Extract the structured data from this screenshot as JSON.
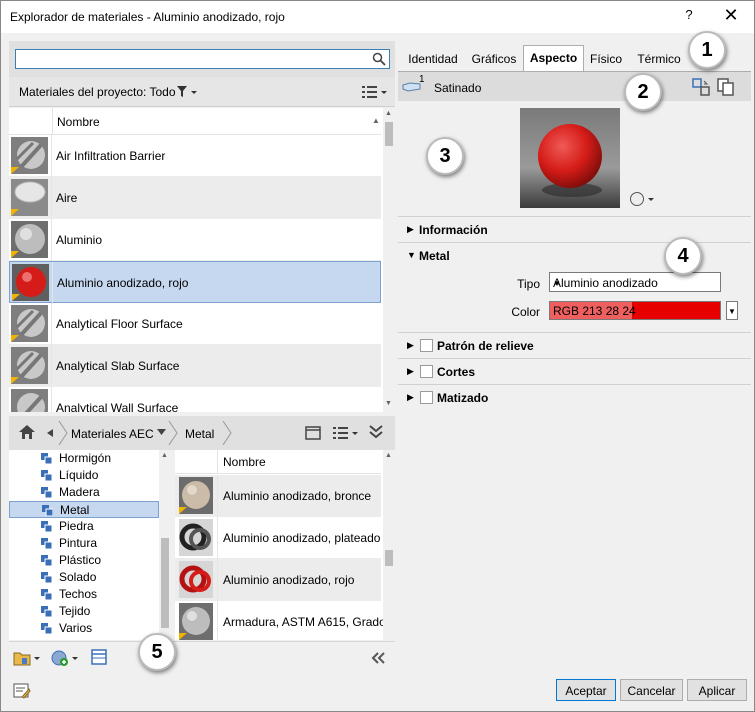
{
  "window": {
    "title": "Explorador de materiales - Aluminio anodizado, rojo",
    "help_label": "?",
    "close_label": "✕"
  },
  "search": {
    "value": "",
    "placeholder": ""
  },
  "project": {
    "filter_label": "Materiales del proyecto: Todo",
    "column_name": "Nombre",
    "materials": [
      {
        "name": "Air Infiltration Barrier",
        "thumb": "striped-sphere-icon"
      },
      {
        "name": "Aire",
        "thumb": "white-sphere-icon"
      },
      {
        "name": "Aluminio",
        "thumb": "grey-sphere-icon"
      },
      {
        "name": "Aluminio anodizado, rojo",
        "thumb": "red-sphere-icon",
        "selected": true
      },
      {
        "name": "Analytical Floor Surface",
        "thumb": "striped-sphere-icon"
      },
      {
        "name": "Analytical Slab Surface",
        "thumb": "striped-sphere-icon"
      },
      {
        "name": "Analytical Wall Surface",
        "thumb": "striped-sphere-icon"
      }
    ]
  },
  "library": {
    "breadcrumb": [
      "Materiales AEC",
      "Metal"
    ],
    "tree": [
      "Hormigón",
      "Líquido",
      "Madera",
      "Metal",
      "Piedra",
      "Pintura",
      "Plástico",
      "Solado",
      "Techos",
      "Tejido",
      "Varios"
    ],
    "tree_selected": "Metal",
    "column_name": "Nombre",
    "items": [
      {
        "name": "Aluminio anodizado, bronce",
        "thumb": "bronze-sphere-icon"
      },
      {
        "name": "Aluminio anodizado, plateado",
        "thumb": "silver-rings-icon"
      },
      {
        "name": "Aluminio anodizado, rojo",
        "thumb": "red-rings-icon"
      },
      {
        "name": "Armadura, ASTM A615, Grado",
        "thumb": "grey-sphere-icon"
      }
    ]
  },
  "tabs": [
    "Identidad",
    "Gráficos",
    "Aspecto",
    "Físico",
    "Térmico"
  ],
  "active_tab": "Aspecto",
  "asset": {
    "count": "1",
    "name": "Satinado"
  },
  "sections": {
    "informacion": "Información",
    "metal": "Metal",
    "patron": "Patrón de relieve",
    "cortes": "Cortes",
    "matizado": "Matizado"
  },
  "properties": {
    "tipo_label": "Tipo",
    "tipo_value": "Aluminio anodizado",
    "color_label": "Color",
    "color_value": "RGB 213 28 24"
  },
  "callouts": [
    "1",
    "2",
    "3",
    "4",
    "5"
  ],
  "buttons": {
    "accept": "Aceptar",
    "cancel": "Cancelar",
    "apply": "Aplicar"
  },
  "colors": {
    "selection": "#c6d8f0",
    "selection_border": "#7da2ce",
    "material_color": "#d51c18",
    "folder_blue": "#3a6fb8"
  }
}
